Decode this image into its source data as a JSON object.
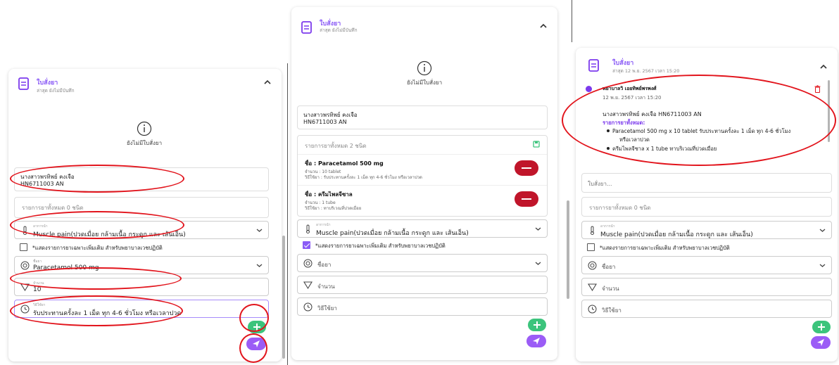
{
  "common": {
    "title": "ใบสั่งยา",
    "latest_none": "ล่าสุด ยังไม่มีบันทึก",
    "no_order": "ยังไม่มีใบสั่งยา",
    "symptom_label": "อาการนำ",
    "symptom_value": "Muscle pain(ปวดเมื่อย กล้ามเนื้อ กระดูก และ เส้นเอ็น)",
    "extra_list_label": "*แสดงรายการยาเฉพาะเพิ่มเติม สำหรับพยาบาลเวชปฏิบัติ",
    "drug_name_label": "ชื่อยา",
    "quantity_label": "จำนวน",
    "usage_label": "วิธีใช้ยา",
    "patient_name": "นางสาวพรทิพย์ คงเจือ",
    "patient_hn": "HN6711003 AN"
  },
  "panel_a": {
    "summary": "รายการยาทั้งหมด 0 ชนิด",
    "drug_name_value": "Paracetamol 500 mg",
    "quantity_value": "10",
    "usage_value": "รับประทานครั้งละ 1 เม็ด ทุก 4-6 ชั่วโมง หรือเวลาปวด"
  },
  "panel_b": {
    "summary": "รายการยาทั้งหมด 2 ชนิด",
    "drugs": [
      {
        "name": "ชื่อ : Paracetamol 500 mg",
        "qty": "จำนวน : 10 tablet",
        "usage": "วิธีใช้ยา : รับประทานครั้งละ 1 เม็ด ทุก 4-6 ชั่วโมง หรือเวลาปวด"
      },
      {
        "name": "ชื่อ : ครีมไพลจีซาล",
        "qty": "จำนวน : 1 tube",
        "usage": "วิธีใช้ยา : ทาบริเวณที่ปวดเมื่อย"
      }
    ]
  },
  "panel_c": {
    "latest": "ล่าสุด 12 พ.ย. 2567 เวลา 15:20",
    "ordered_by": "พยาบาลวิ เอยทิพย์พรพงศ์",
    "order_time": "12 พ.ย. 2567 เวลา 15:20",
    "patient_line": "นางสาวพรทิพย์ คงเจือ HN6711003 AN",
    "items_header": "รายการยาทั้งหมด:",
    "item1": "Paracetamol 500 mg x 10 tablet รับประทานครั้งละ 1 เม็ด ทุก 4-6 ชั่วโมง",
    "item1_cont": "หรือเวลาปวด",
    "item2": "ครีมไพลจีซาล x 1 tube ทาบริเวณที่ปวดเมื่อย",
    "order_input_placeholder": "ใบสั่งยา...",
    "summary": "รายการยาทั้งหมด 0 ชนิด"
  },
  "colors": {
    "accent": "#8b5cf6",
    "add_button": "#3cc47c",
    "remove_button": "#c0152a",
    "annotation": "#e2141c"
  }
}
